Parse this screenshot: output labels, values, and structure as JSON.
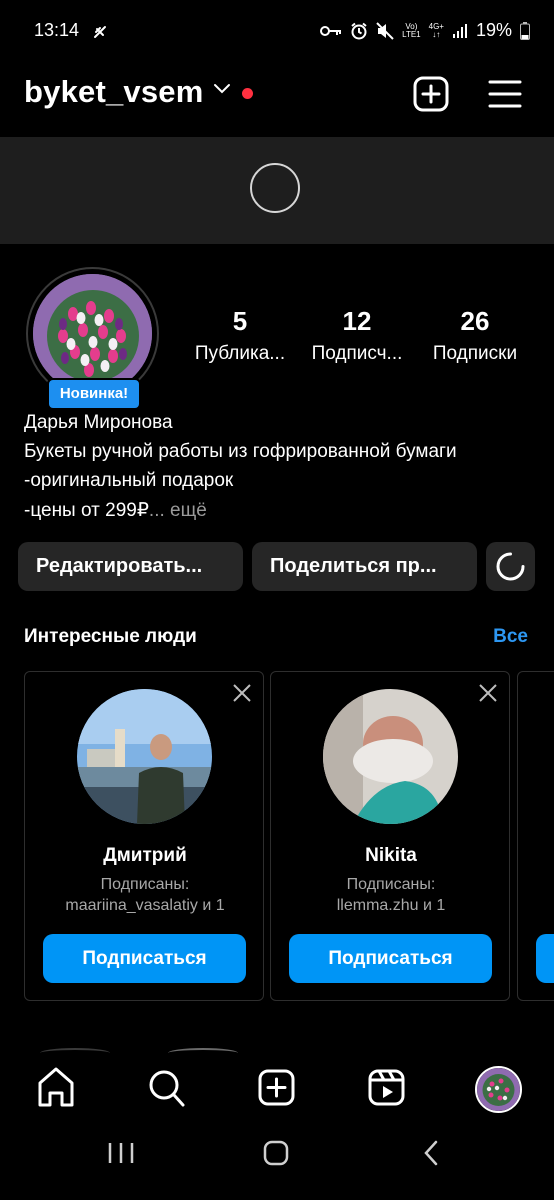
{
  "status": {
    "time": "13:14",
    "volte_top": "Vo)",
    "volte_bottom": "LTE1",
    "net_top": "4G+",
    "net_bottom": "↓↑",
    "battery": "19%"
  },
  "header": {
    "username": "byket_vsem"
  },
  "profile": {
    "badge": "Новинка!",
    "name": "Дарья Миронова",
    "bio": [
      "Букеты ручной работы из гофрированной бумаги",
      "-оригинальный  подарок",
      "-цены от 299₽"
    ],
    "bio_more": "... ещё",
    "stats": [
      {
        "value": "5",
        "label": "Публика..."
      },
      {
        "value": "12",
        "label": "Подписч..."
      },
      {
        "value": "26",
        "label": "Подписки"
      }
    ]
  },
  "actions": {
    "edit": "Редактировать...",
    "share": "Поделиться пр..."
  },
  "suggestions": {
    "title": "Интересные люди",
    "see_all": "Все",
    "cards": [
      {
        "name": "Дмитрий",
        "followed_label": "Подписаны:",
        "followed_by": "maariina_vasalatiy и 1",
        "button": "Подписаться"
      },
      {
        "name": "Nikita",
        "followed_label": "Подписаны:",
        "followed_by": "llemma.zhu и 1",
        "button": "Подписаться"
      }
    ]
  },
  "colors": {
    "accent": "#0095f6",
    "link": "#2d97f2",
    "badge": "#1d8ff0",
    "notification_dot": "#ff3040",
    "background": "#000000",
    "button_dark": "#262626"
  },
  "icons": [
    "add-post-icon",
    "menu-icon",
    "chevron-down-icon",
    "home-icon",
    "search-icon",
    "create-icon",
    "reels-icon",
    "close-icon"
  ]
}
